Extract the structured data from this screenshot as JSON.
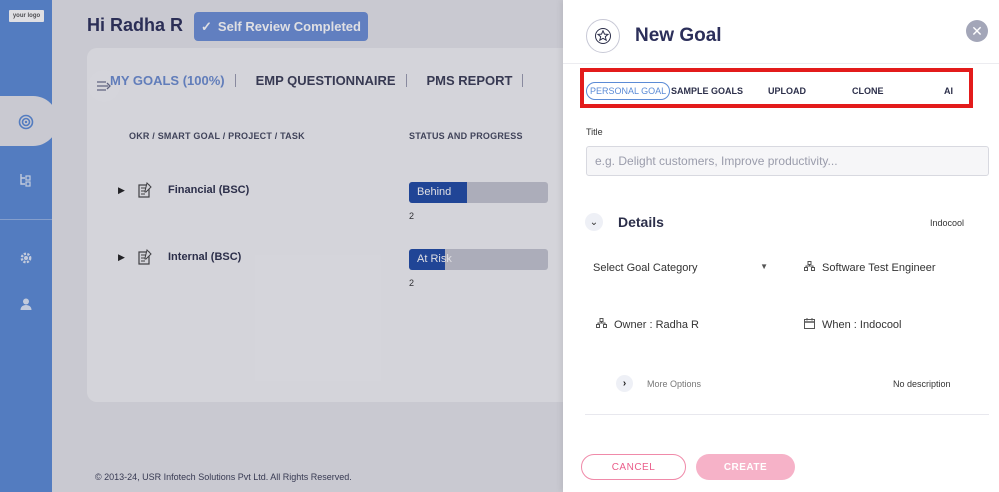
{
  "brand": {
    "logo_text": "your logo"
  },
  "header": {
    "greeting": "Hi Radha R",
    "review_button": "Self Review Completed"
  },
  "main": {
    "tabs": [
      "MY GOALS (100%)",
      "EMP QUESTIONNAIRE",
      "PMS REPORT"
    ],
    "columns": [
      "OKR / SMART GOAL / PROJECT / TASK",
      "STATUS AND PROGRESS"
    ],
    "rows": [
      {
        "label": "Financial (BSC)",
        "status": "Behind",
        "progress": 0.42,
        "count": "2"
      },
      {
        "label": "Internal (BSC)",
        "status": "At Risk",
        "progress": 0.26,
        "count": "2"
      }
    ]
  },
  "footer": {
    "text": "© 2013-24, USR Infotech Solutions Pvt Ltd. All Rights Reserved."
  },
  "panel": {
    "title": "New Goal",
    "goal_tabs": [
      "PERSONAL GOAL",
      "SAMPLE GOALS",
      "UPLOAD",
      "CLONE",
      "AI"
    ],
    "active_tab": "PERSONAL GOAL",
    "title_label": "Title",
    "title_placeholder": "e.g. Delight customers, Improve productivity...",
    "details_label": "Details",
    "org_top": "Indocool",
    "category_placeholder": "Select Goal Category",
    "role": "Software Test Engineer",
    "owner": "Owner : Radha R",
    "when": "When : Indocool",
    "more_options": "More Options",
    "description": "No description",
    "cancel_label": "CANCEL",
    "create_label": "CREATE"
  },
  "colors": {
    "sidebar": "#5b8bd6",
    "accent": "#5b8bd6",
    "progress_fill": "#1f4aa5",
    "highlight_box": "#e31b1b",
    "cancel": "#ea5d8a",
    "create": "#f6b2c8"
  },
  "icons": {
    "sidebar": [
      "collapse-icon",
      "target-icon",
      "hierarchy-icon",
      "gear-icon",
      "user-icon"
    ],
    "panel": [
      "star-badge-icon",
      "close-icon",
      "org-chart-icon",
      "calendar-icon"
    ]
  }
}
